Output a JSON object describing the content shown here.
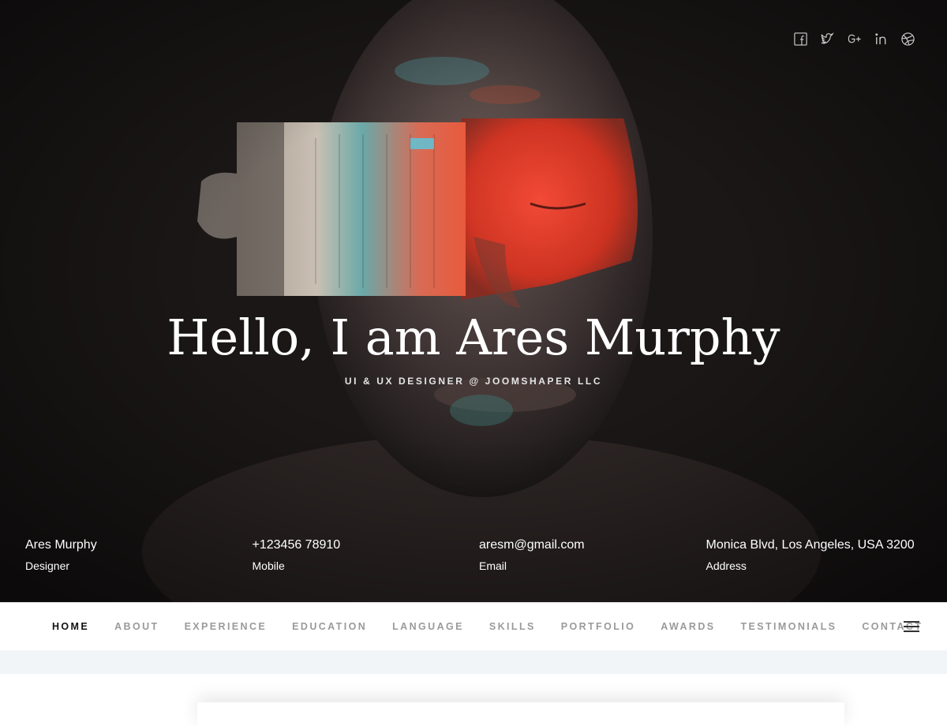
{
  "hero": {
    "title": "Hello, I am Ares Murphy",
    "subtitle": "UI & UX DESIGNER @ JOOMSHAPER LLC",
    "social": [
      {
        "name": "facebook-icon"
      },
      {
        "name": "twitter-icon"
      },
      {
        "name": "google-plus-icon"
      },
      {
        "name": "linkedin-icon"
      },
      {
        "name": "dribbble-icon"
      }
    ],
    "info": [
      {
        "value": "Ares Murphy",
        "label": "Designer"
      },
      {
        "value": "+123456 78910",
        "label": "Mobile"
      },
      {
        "value": "aresm@gmail.com",
        "label": "Email"
      },
      {
        "value": "Monica Blvd, Los Angeles, USA 3200",
        "label": "Address"
      }
    ]
  },
  "nav": {
    "items": [
      {
        "label": "HOME",
        "active": true
      },
      {
        "label": "ABOUT"
      },
      {
        "label": "EXPERIENCE"
      },
      {
        "label": "EDUCATION"
      },
      {
        "label": "LANGUAGE"
      },
      {
        "label": "SKILLS"
      },
      {
        "label": "PORTFOLIO"
      },
      {
        "label": "AWARDS"
      },
      {
        "label": "TESTIMONIALS"
      },
      {
        "label": "CONTACT"
      }
    ],
    "menu_icon": "hamburger-menu-icon"
  },
  "colors": {
    "hero_bg": "#1b1717",
    "paint_red": "#e8372a",
    "paint_teal": "#5fb8b6",
    "nav_active": "#111111",
    "nav_inactive": "#9a9a9a",
    "strip_bg": "#f2f5f8"
  }
}
